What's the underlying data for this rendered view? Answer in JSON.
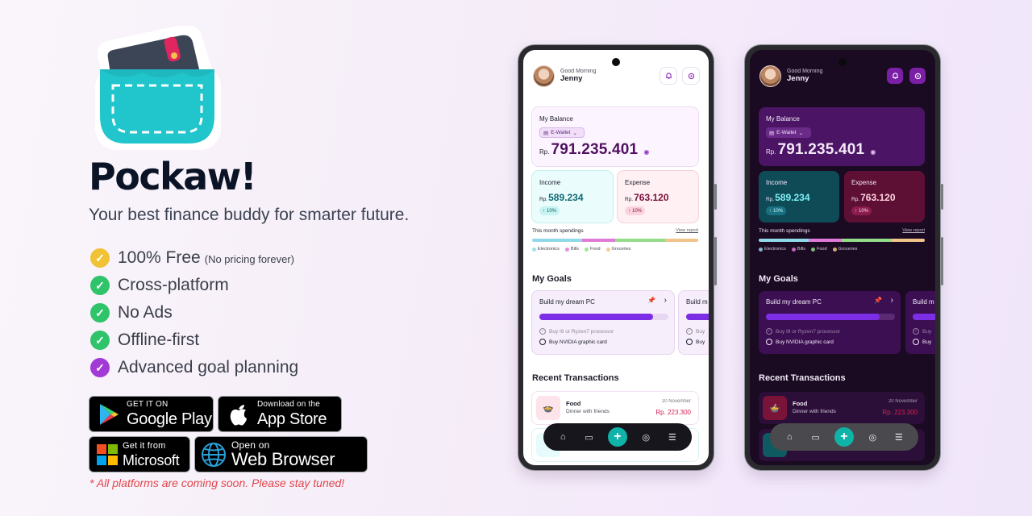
{
  "promo": {
    "app_name": "Pockaw!",
    "tagline": "Your best finance buddy for smarter future.",
    "features": [
      {
        "label": "100% Free",
        "note": "(No pricing forever)",
        "color": "#f2c236"
      },
      {
        "label": "Cross-platform",
        "note": "",
        "color": "#2fc46a"
      },
      {
        "label": "No Ads",
        "note": "",
        "color": "#2fc46a"
      },
      {
        "label": "Offline-first",
        "note": "",
        "color": "#2fc46a"
      },
      {
        "label": "Advanced goal planning",
        "note": "",
        "color": "#a23ad6"
      }
    ],
    "stores": {
      "google": {
        "small": "GET IT ON",
        "big": "Google Play"
      },
      "apple": {
        "small": "Download on the",
        "big": "App Store"
      },
      "microsoft": {
        "small": "Get it from",
        "big": "Microsoft"
      },
      "web": {
        "small": "Open on",
        "big": "Web Browser"
      }
    },
    "disclaimer": "* All platforms are coming soon. Please stay tuned!"
  },
  "app": {
    "greeting": "Good Morning",
    "user_name": "Jenny",
    "balance_label": "My Balance",
    "wallet": "E-Wallet",
    "currency": "Rp.",
    "balance": "791.235.401",
    "income_label": "Income",
    "income": "589.234",
    "income_change": "10%",
    "expense_label": "Expense",
    "expense": "763.120",
    "expense_change": "10%",
    "spendings_label": "This month spendings",
    "view_report": "View report",
    "spend_categories": [
      {
        "name": "Electronics",
        "color": "#8fd9e8",
        "share": 0.3
      },
      {
        "name": "Bills",
        "color": "#e07ad8",
        "share": 0.2
      },
      {
        "name": "Food",
        "color": "#94dc8a",
        "share": 0.3
      },
      {
        "name": "Groceries",
        "color": "#f0c48a",
        "share": 0.2
      }
    ],
    "goals_title": "My Goals",
    "goal_title": "Build my dream PC",
    "goal_title_peek": "Build m",
    "goal_progress": 0.88,
    "goal_tasks": [
      {
        "label": "Buy I9 or Ryzen7 processor",
        "done": true
      },
      {
        "label": "Buy NVIDIA graphic card",
        "done": false
      }
    ],
    "goal_tasks_peek": [
      "Buy",
      "Buy"
    ],
    "transactions_title": "Recent Transactions",
    "tx": {
      "category": "Food",
      "desc": "Dinner with friends",
      "date": "20 November",
      "amount": "Rp. 223.300"
    }
  },
  "colors": {
    "accent_teal": "#0fb3a8",
    "accent_purple": "#7c2ee6",
    "expense_red": "#d81f55"
  }
}
